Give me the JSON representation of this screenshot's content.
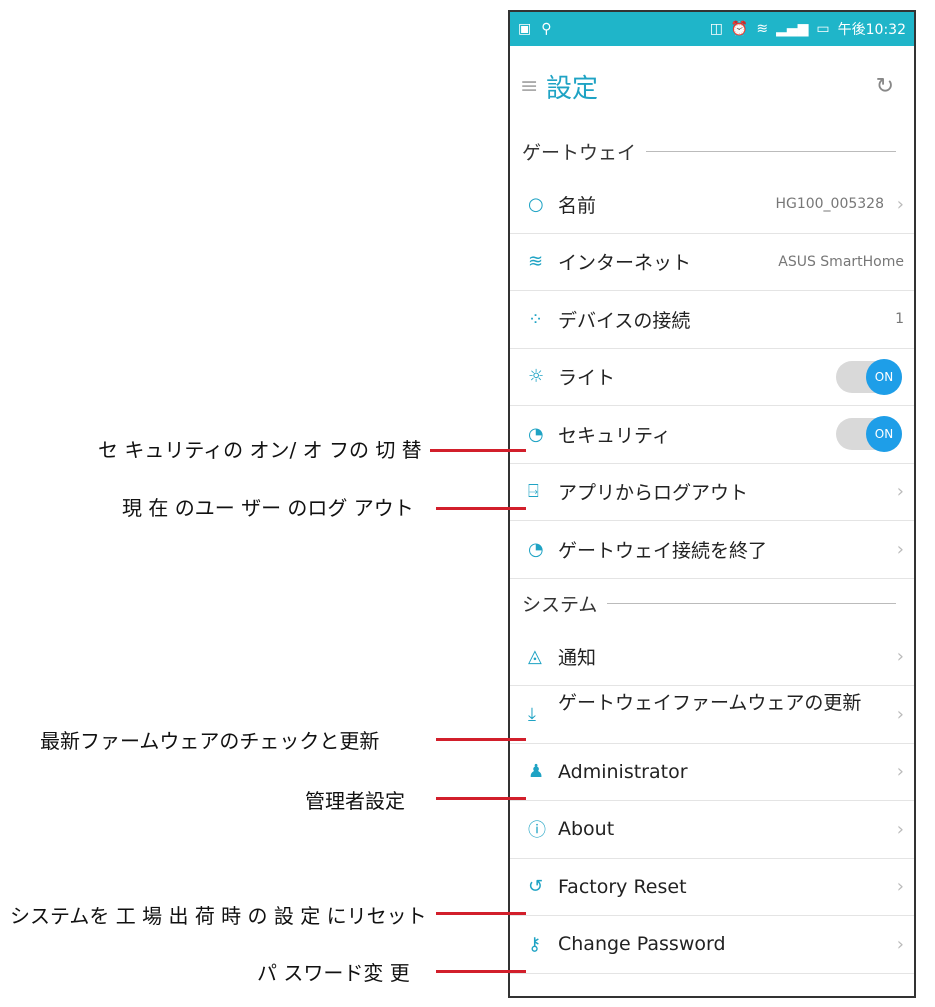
{
  "status_bar": {
    "time": "午後10:32"
  },
  "app_bar": {
    "title": "設定"
  },
  "sections": {
    "gateway": "ゲートウェイ",
    "system": "システム"
  },
  "gateway_items": [
    {
      "icon": "circle-icon",
      "label": "名前",
      "value": "HG100_005328"
    },
    {
      "icon": "wifi-icon",
      "label": "インターネット",
      "value": "ASUS SmartHome"
    },
    {
      "icon": "devices-icon",
      "label": "デバイスの接続",
      "value": "1"
    },
    {
      "icon": "sun-icon",
      "label": "ライト",
      "toggle": "ON"
    },
    {
      "icon": "security-icon",
      "label": "セキュリティ",
      "toggle": "ON"
    },
    {
      "icon": "logout-icon",
      "label": "アプリからログアウト"
    },
    {
      "icon": "disconnect-icon",
      "label": "ゲートウェイ接続を終了"
    }
  ],
  "system_items": [
    {
      "icon": "bell-icon",
      "label": "通知"
    },
    {
      "icon": "download-icon",
      "label": "ゲートウェイファームウェアの更新"
    },
    {
      "icon": "admin-icon",
      "label": "Administrator"
    },
    {
      "icon": "info-icon",
      "label": "About"
    },
    {
      "icon": "reset-icon",
      "label": "Factory Reset"
    },
    {
      "icon": "key-icon",
      "label": "Change Password"
    }
  ],
  "annotations": {
    "security_toggle": "セ キュリティの オン/ オ フの 切 替",
    "logout": "現 在 のユー ザー のログ アウト",
    "firmware": "最新ファームウェアのチェックと更新",
    "admin": "管理者設定",
    "factory_reset": "システムを 工 場 出 荷 時 の 設 定 にリセット",
    "password": "パ スワード変 更"
  }
}
